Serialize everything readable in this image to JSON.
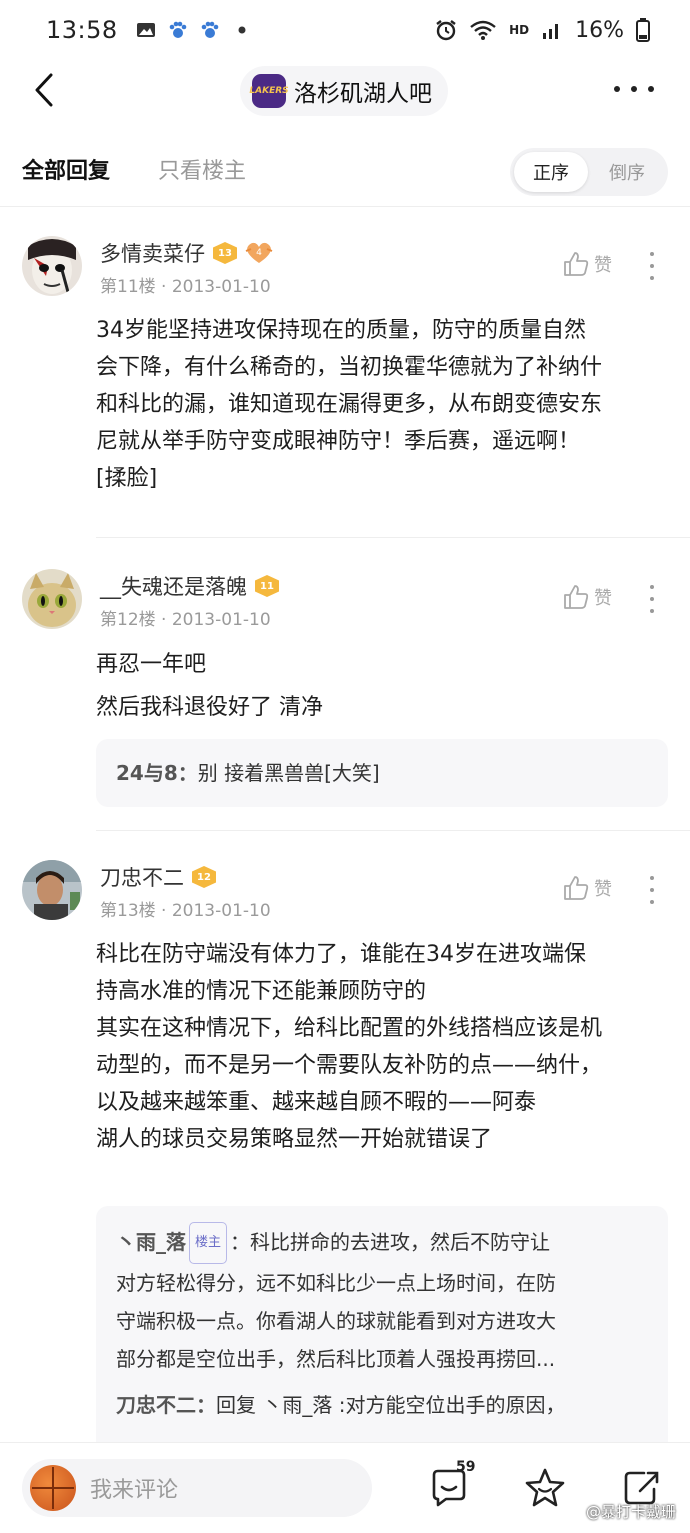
{
  "status_bar": {
    "time": "13:58",
    "network": "HD",
    "battery": "16%"
  },
  "nav": {
    "forum_name": "洛杉矶湖人吧",
    "logo_text": "LAKERS"
  },
  "tabs": {
    "all_replies": "全部回复",
    "only_op": "只看楼主",
    "order_asc": "正序",
    "order_desc": "倒序"
  },
  "posts": [
    {
      "username": "多情卖菜仔",
      "level": "13",
      "heart_level": "4",
      "floor": "第11楼",
      "date": "2013-01-10",
      "like_label": "赞",
      "lines": [
        "34岁能坚持进攻保持现在的质量，防守的质量自然",
        "会下降，有什么稀奇的，当初换霍华德就为了补纳什",
        "和科比的漏，谁知道现在漏得更多，从布朗变德安东",
        "尼就从举手防守变成眼神防守！季后赛，遥远啊！",
        "[揉脸]"
      ]
    },
    {
      "username": "__失魂还是落魄",
      "level": "11",
      "floor": "第12楼",
      "date": "2013-01-10",
      "like_label": "赞",
      "lines": [
        "再忍一年吧",
        "然后我科退役好了 清净"
      ],
      "sub_replies": [
        {
          "author": "24与8：",
          "text": "别 接着黑兽兽[大笑]"
        }
      ]
    },
    {
      "username": "刀忠不二",
      "level": "12",
      "floor": "第13楼",
      "date": "2013-01-10",
      "like_label": "赞",
      "lines": [
        "科比在防守端没有体力了，谁能在34岁在进攻端保",
        "持高水准的情况下还能兼顾防守的",
        "其实在这种情况下，给科比配置的外线搭档应该是机",
        "动型的，而不是另一个需要队友补防的点——纳什，",
        "以及越来越笨重、越来越自顾不暇的——阿泰",
        "湖人的球员交易策略显然一开始就错误了"
      ],
      "sub_replies": [
        {
          "author": "丶雨_落",
          "op_tag": "楼主",
          "lines": [
            "：科比拼命的去进攻，然后不防守让",
            "对方轻松得分，远不如科比少一点上场时间，在防",
            "守端积极一点。你看湖人的球就能看到对方进攻大",
            "部分都是空位出手，然后科比顶着人强投再捞回..."
          ]
        },
        {
          "author": "刀忠不二：",
          "text": "回复 丶雨_落 :对方能空位出手的原因，"
        }
      ]
    }
  ],
  "bottom_bar": {
    "placeholder": "我来评论",
    "comment_count": "59",
    "watermark": "@暴打卡戴珊"
  }
}
